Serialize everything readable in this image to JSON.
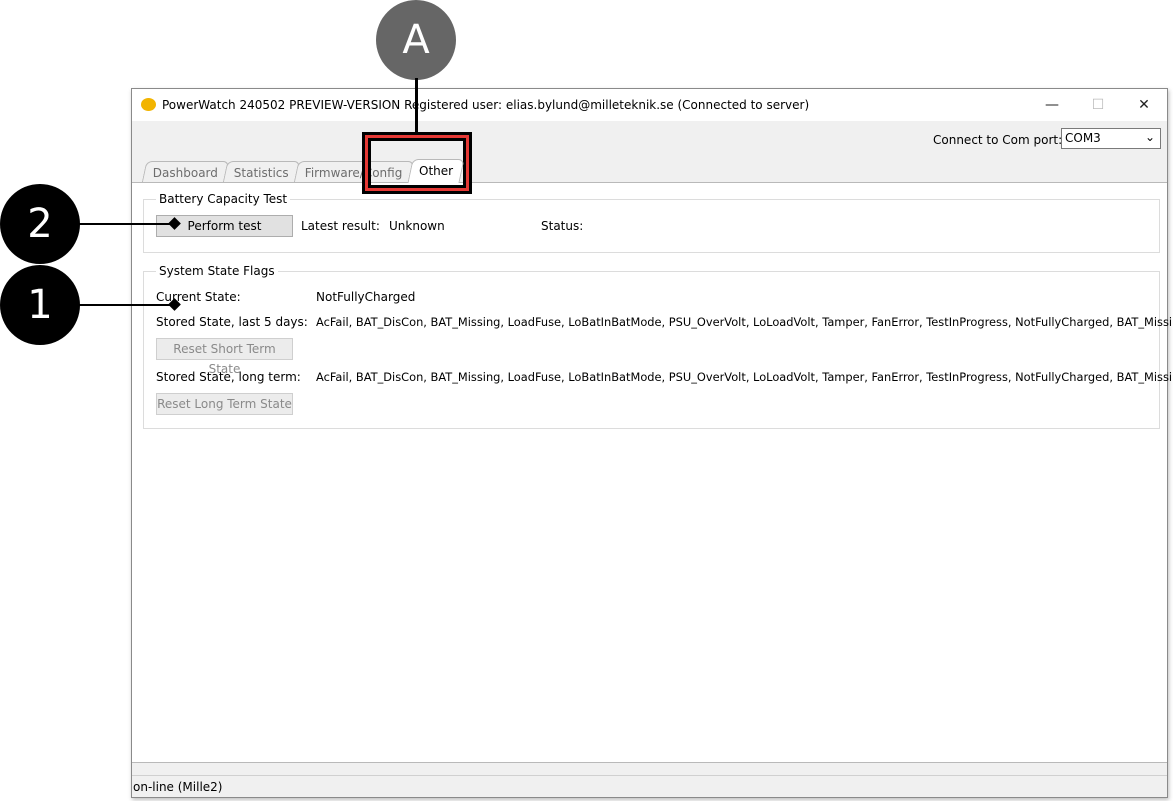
{
  "window": {
    "title": "PowerWatch 240502 PREVIEW-VERSION Registered user: elias.bylund@milleteknik.se (Connected to server)",
    "controls": {
      "minimize": "—",
      "maximize": "☐",
      "close": "✕"
    }
  },
  "toolbar": {
    "com_label": "Connect to Com port:",
    "com_value": "COM3"
  },
  "tabs": [
    {
      "label": "Dashboard"
    },
    {
      "label": "Statistics"
    },
    {
      "label": "Firmware/Config"
    },
    {
      "label": "Other",
      "active": true
    }
  ],
  "battery": {
    "title": "Battery Capacity Test",
    "perform_label": "Perform test",
    "latest_label": "Latest result:",
    "latest_value": "Unknown",
    "status_label": "Status:"
  },
  "flags": {
    "title": "System State Flags",
    "current_label": "Current State:",
    "current_value": "NotFullyCharged",
    "short_label": "Stored State, last 5 days:",
    "short_value": "AcFail, BAT_DisCon, BAT_Missing, LoadFuse, LoBatInBatMode, PSU_OverVolt, LoLoadVolt, Tamper, FanError, TestInProgress, NotFullyCharged, BAT_Missing,...",
    "reset_short": "Reset Short Term State",
    "long_label": "Stored State, long term:",
    "long_value": "AcFail, BAT_DisCon, BAT_Missing, LoadFuse, LoBatInBatMode, PSU_OverVolt, LoLoadVolt, Tamper, FanError, TestInProgress, NotFullyCharged, BAT_Missing,...",
    "reset_long": "Reset Long Term State"
  },
  "statusbar": {
    "text": "on-line (Mille2)"
  },
  "annotations": {
    "a": "A",
    "two": "2",
    "one": "1",
    "highlight_color": "#e53935"
  }
}
